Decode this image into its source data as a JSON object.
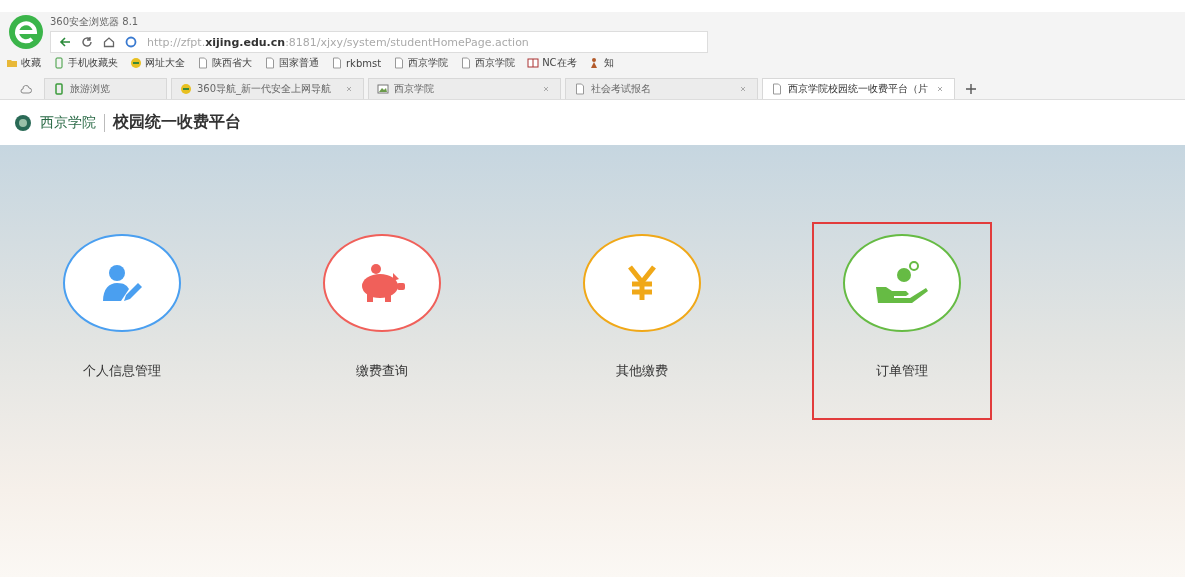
{
  "browser": {
    "title": "360安全浏览器 8.1",
    "url": "http://zfpt.**xijing.edu.cn**:8181/xjxy/system/studentHomePage.action",
    "bookmarks": [
      {
        "label": "收藏",
        "kind": "folder"
      },
      {
        "label": "手机收藏夹",
        "kind": "phone"
      },
      {
        "label": "网址大全",
        "kind": "site"
      },
      {
        "label": "陕西省大",
        "kind": "page"
      },
      {
        "label": "国家普通",
        "kind": "page"
      },
      {
        "label": "rkbmst",
        "kind": "page"
      },
      {
        "label": "西京学院",
        "kind": "page"
      },
      {
        "label": "西京学院",
        "kind": "page"
      },
      {
        "label": "NC在考",
        "kind": "book"
      },
      {
        "label": "知",
        "kind": "zhi"
      }
    ],
    "tabs": [
      {
        "label": "旅游浏览",
        "kind": "pinned",
        "selected": false
      },
      {
        "label": "360导航_新一代安全上网导航",
        "kind": "site",
        "selected": false
      },
      {
        "label": "西京学院",
        "kind": "image",
        "selected": false
      },
      {
        "label": "社会考试报名",
        "kind": "page",
        "selected": false
      },
      {
        "label": "西京学院校园统一收费平台（片",
        "kind": "page",
        "selected": true
      }
    ]
  },
  "site": {
    "logo_text": "西京学院",
    "title": "校园统一收费平台",
    "modules": [
      {
        "label": "个人信息管理",
        "kind": "user-edit",
        "color": "#4a9ff0",
        "highlighted": false
      },
      {
        "label": "缴费查询",
        "kind": "piggy",
        "color": "#f0605a",
        "highlighted": false
      },
      {
        "label": "其他缴费",
        "kind": "yen",
        "color": "#f0a818",
        "highlighted": false
      },
      {
        "label": "订单管理",
        "kind": "coin-hand",
        "color": "#66bb44",
        "highlighted": true
      }
    ]
  }
}
